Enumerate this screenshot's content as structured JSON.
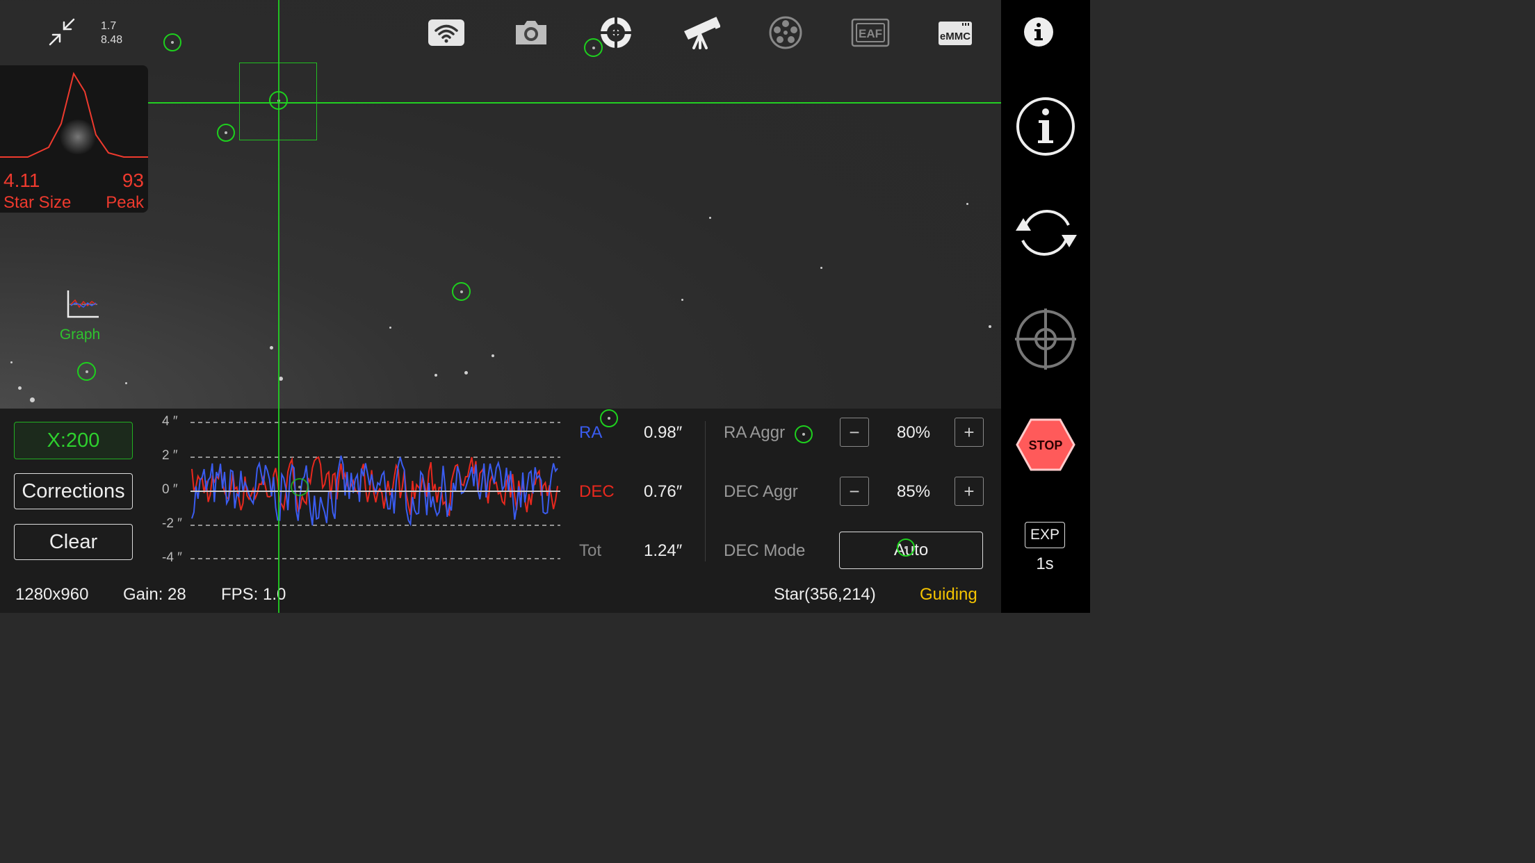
{
  "zoom": {
    "line1": "1.7",
    "line2": "8.48"
  },
  "toolbar": {
    "icons": [
      "wifi-icon",
      "camera-icon",
      "guide-target-icon",
      "telescope-icon",
      "filter-wheel-icon",
      "eaf-icon",
      "emmc-icon"
    ],
    "eaf_label": "EAF",
    "emmc_label": "eMMC"
  },
  "star_profile": {
    "star_size_value": "4.11",
    "star_size_label": "Star Size",
    "peak_value": "93",
    "peak_label": "Peak"
  },
  "graph_button": {
    "label": "Graph"
  },
  "controls": {
    "scale_label": "X:200",
    "corrections_label": "Corrections",
    "clear_label": "Clear"
  },
  "graph": {
    "y_ticks": [
      "4 ″",
      "2 ″",
      "0 ″",
      "-2 ″",
      "-4 ″"
    ],
    "colors": {
      "ra": "#3a5cf0",
      "dec": "#e8281e",
      "zero": "#cccccc"
    }
  },
  "rms": {
    "ra_label": "RA",
    "ra_value": "0.98″",
    "dec_label": "DEC",
    "dec_value": "0.76″",
    "tot_label": "Tot",
    "tot_value": "1.24″"
  },
  "aggressiveness": {
    "ra_label": "RA Aggr",
    "ra_value": "80%",
    "dec_label": "DEC Aggr",
    "dec_value": "85%",
    "minus": "−",
    "plus": "+",
    "dec_mode_label": "DEC Mode",
    "dec_mode_value": "Auto"
  },
  "status": {
    "resolution": "1280x960",
    "gain": "Gain: 28",
    "fps": "FPS: 1.0",
    "star": "Star(356,214)",
    "state": "Guiding",
    "state_color": "#f5c400"
  },
  "sidebar": {
    "stop_label": "STOP",
    "exp_label": "EXP",
    "exp_value": "1s"
  }
}
